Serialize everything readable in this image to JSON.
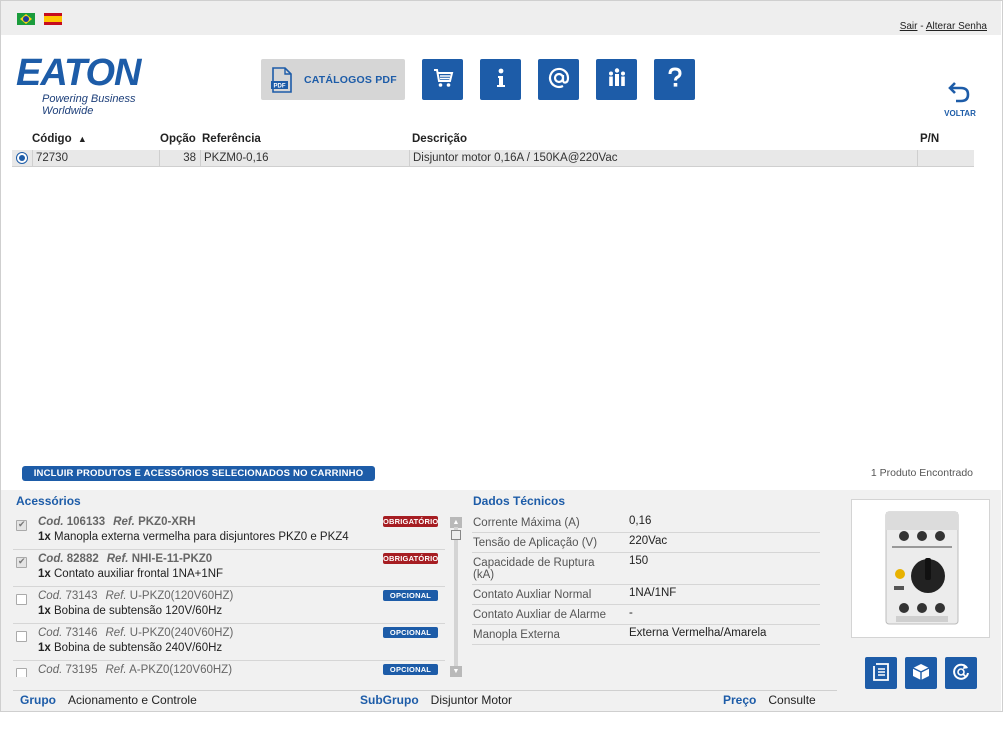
{
  "top": {
    "flags": [
      "flag-brazil-icon",
      "flag-spain-icon"
    ],
    "sair": "Sair",
    "separator": "-",
    "alterar_senha": "Alterar Senha"
  },
  "logo": {
    "word": "EATON",
    "tagline": "Powering Business Worldwide"
  },
  "toolbar": {
    "catalogos_label": "CATÁLOGOS PDF",
    "buttons": [
      "cart-icon",
      "info-icon",
      "at-icon",
      "people-icon",
      "help-icon"
    ]
  },
  "voltar_label": "VOLTAR",
  "table": {
    "headers": {
      "codigo": "Código",
      "opcao": "Opção",
      "referencia": "Referência",
      "descricao": "Descrição",
      "pn": "P/N"
    },
    "rows": [
      {
        "codigo": "72730",
        "opcao": "38",
        "referencia": "PKZM0-0,16",
        "descricao": "Disjuntor motor 0,16A / 150KA@220Vac",
        "pn": ""
      }
    ]
  },
  "incluir_label": "INCLUIR PRODUTOS E ACESSÓRIOS SELECIONADOS NO CARRINHO",
  "encontrado": "1 Produto Encontrado",
  "acessorios": {
    "title": "Acessórios",
    "cod_label": "Cod.",
    "ref_label": "Ref.",
    "items": [
      {
        "cod": "106133",
        "ref": "PKZ0-XRH",
        "qty": "1x",
        "desc": "Manopla externa vermelha para disjuntores PKZ0 e PKZ4",
        "badge": "OBRIGATÓRIO",
        "checked": true
      },
      {
        "cod": "82882",
        "ref": "NHI-E-11-PKZ0",
        "qty": "1x",
        "desc": "Contato auxiliar frontal 1NA+1NF",
        "badge": "OBRIGATÓRIO",
        "checked": true
      },
      {
        "cod": "73143",
        "ref": "U-PKZ0(120V60HZ)",
        "qty": "1x",
        "desc": "Bobina de subtensão 120V/60Hz",
        "badge": "OPCIONAL",
        "checked": false
      },
      {
        "cod": "73146",
        "ref": "U-PKZ0(240V60HZ)",
        "qty": "1x",
        "desc": "Bobina de subtensão 240V/60Hz",
        "badge": "OPCIONAL",
        "checked": false
      },
      {
        "cod": "73195",
        "ref": "A-PKZ0(120V60HZ)",
        "qty": "",
        "desc": "",
        "badge": "OPCIONAL",
        "checked": false
      }
    ]
  },
  "dados": {
    "title": "Dados Técnicos",
    "rows": [
      {
        "k": "Corrente Máxima (A)",
        "v": "0,16"
      },
      {
        "k": "Tensão de Aplicação (V)",
        "v": "220Vac"
      },
      {
        "k": "Capacidade de Ruptura (kA)",
        "v": "150"
      },
      {
        "k": "Contato Auxliar Normal",
        "v": "1NA/1NF"
      },
      {
        "k": "Contato Auxliar de Alarme",
        "v": "-"
      },
      {
        "k": "Manopla Externa",
        "v": "Externa Vermelha/Amarela"
      }
    ]
  },
  "footer": {
    "grupo_label": "Grupo",
    "grupo": "Acionamento e Controle",
    "subgrupo_label": "SubGrupo",
    "subgrupo": "Disjuntor Motor",
    "preco_label": "Preço",
    "preco": "Consulte"
  },
  "actions": [
    "document-icon",
    "box-icon",
    "refresh-search-icon"
  ],
  "colors": {
    "accent": "#1d5ca8",
    "required": "#a61d22"
  }
}
